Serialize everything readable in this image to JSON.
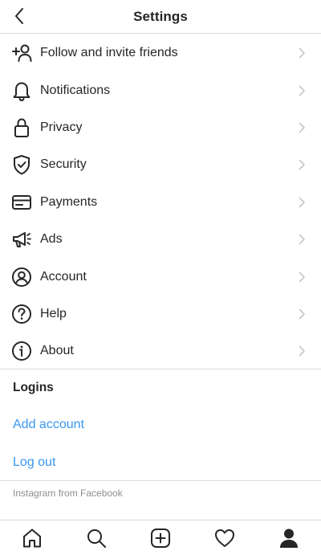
{
  "header": {
    "title": "Settings"
  },
  "menu": {
    "items": [
      {
        "label": "Follow and invite friends",
        "icon": "add-person-icon"
      },
      {
        "label": "Notifications",
        "icon": "bell-icon"
      },
      {
        "label": "Privacy",
        "icon": "lock-icon"
      },
      {
        "label": "Security",
        "icon": "shield-icon"
      },
      {
        "label": "Payments",
        "icon": "credit-card-icon"
      },
      {
        "label": "Ads",
        "icon": "megaphone-icon"
      },
      {
        "label": "Account",
        "icon": "account-icon"
      },
      {
        "label": "Help",
        "icon": "help-icon"
      },
      {
        "label": "About",
        "icon": "info-icon"
      }
    ]
  },
  "logins": {
    "heading": "Logins",
    "add_account": "Add account",
    "log_out": "Log out"
  },
  "footer": {
    "text": "Instagram from Facebook"
  },
  "colors": {
    "text": "#262626",
    "link": "#3897f0",
    "muted": "#8e8e8e",
    "divider": "#dbdbdb"
  },
  "tabbar": {
    "tabs": [
      "home-icon",
      "search-icon",
      "new-post-icon",
      "heart-icon",
      "profile-icon"
    ]
  }
}
